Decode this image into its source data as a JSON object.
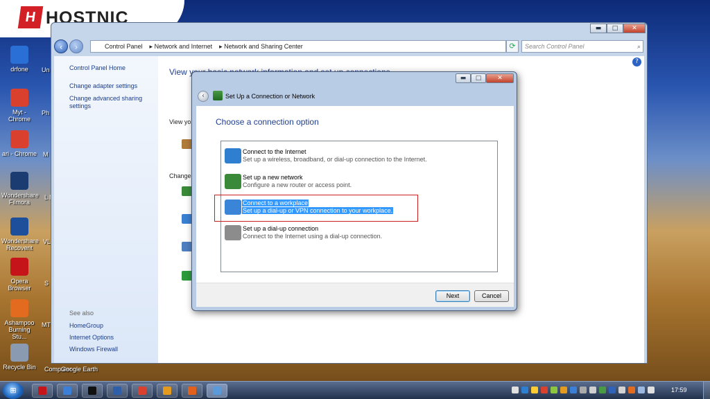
{
  "logo": {
    "mark": "H",
    "text": "HOSTNIC"
  },
  "desktop_icons": [
    {
      "label": "drfone",
      "color": "#2a6fd6"
    },
    {
      "label": "Myt - Chrome",
      "color": "#d9412e"
    },
    {
      "label": "ari - Chrome",
      "color": "#d9412e"
    },
    {
      "label": "Wondershare Filmora",
      "color": "#1b3c70"
    },
    {
      "label": "Wondershare Recoverit",
      "color": "#1d4f9b"
    },
    {
      "label": "Opera Browser",
      "color": "#c6141b"
    },
    {
      "label": "Ashampoo Burning Stu...",
      "color": "#e36b1f"
    },
    {
      "label": "Recycle Bin",
      "color": "#8a9ab0"
    }
  ],
  "desktop_fragments": [
    "Un",
    "Ph",
    "M",
    "L N",
    "VL",
    "S",
    "MT",
    "Computer",
    "Google Earth"
  ],
  "window": {
    "breadcrumbs": [
      "Control Panel",
      "Network and Internet",
      "Network and Sharing Center"
    ],
    "search_placeholder": "Search Control Panel",
    "controls": {
      "minimize": "▬",
      "maximize": "□",
      "close": "✕"
    }
  },
  "sidebar": {
    "home": "Control Panel Home",
    "links": [
      "Change adapter settings",
      "Change advanced sharing settings"
    ],
    "see_also_label": "See also",
    "see_also_links": [
      "HomeGroup",
      "Internet Options",
      "Windows Firewall"
    ]
  },
  "main": {
    "heading": "View your basic network information and set up connections",
    "view_fragment": "View yo",
    "change_fragment": "Change"
  },
  "dialog": {
    "title": "Set Up a Connection or Network",
    "heading": "Choose a connection option",
    "options": [
      {
        "title": "Connect to the Internet",
        "desc": "Set up a wireless, broadband, or dial-up connection to the Internet.",
        "selected": false,
        "icon_color": "#2e7fd0"
      },
      {
        "title": "Set up a new network",
        "desc": "Configure a new router or access point.",
        "selected": false,
        "icon_color": "#3a8a3a"
      },
      {
        "title": "Connect to a workplace",
        "desc": "Set up a dial-up or VPN connection to your workplace.",
        "selected": true,
        "icon_color": "#3a85d8"
      },
      {
        "title": "Set up a dial-up connection",
        "desc": "Connect to the Internet using a dial-up connection.",
        "selected": false,
        "icon_color": "#8c8c8c"
      }
    ],
    "next_label": "Next",
    "cancel_label": "Cancel"
  },
  "taskbar": {
    "apps": [
      {
        "name": "opera",
        "color": "#c6141b",
        "active": false
      },
      {
        "name": "explorer",
        "color": "#3b7fd6",
        "active": false
      },
      {
        "name": "cmd",
        "color": "#111111",
        "active": false
      },
      {
        "name": "media",
        "color": "#2e5fa8",
        "active": false
      },
      {
        "name": "chrome",
        "color": "#d9412e",
        "active": false
      },
      {
        "name": "app",
        "color": "#e39a1f",
        "active": false
      },
      {
        "name": "firefox",
        "color": "#e2601b",
        "active": false
      },
      {
        "name": "control-panel",
        "color": "#5a9ad8",
        "active": true
      }
    ],
    "clock": "17:59"
  }
}
